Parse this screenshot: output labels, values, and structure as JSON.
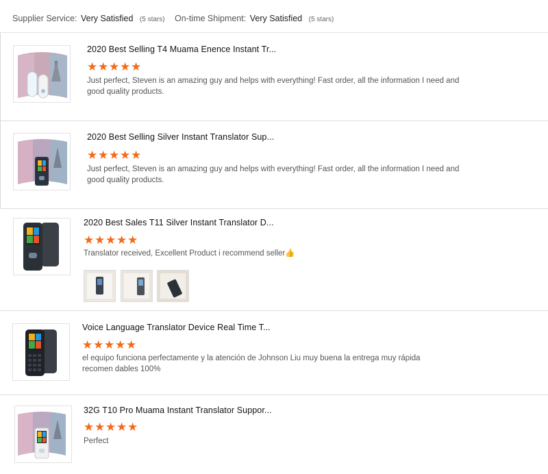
{
  "summary": {
    "supplier_label": "Supplier Service:",
    "supplier_value": "Very Satisfied",
    "supplier_stars": "(5 stars)",
    "shipment_label": "On-time Shipment:",
    "shipment_value": "Very Satisfied",
    "shipment_stars": "(5 stars)"
  },
  "colors": {
    "star": "#f26a1b",
    "divider": "#dcdcdc"
  },
  "reviews": [
    {
      "title": "2020 Best Selling T4 Muama Enence Instant Tr...",
      "stars": 5,
      "text": "Just perfect, Steven is an amazing guy and helps with everything! Fast order, all the information  I need and good quality products.",
      "thumb_icon": "product-thumbnail-t4-translator"
    },
    {
      "title": "2020 Best Selling Silver Instant Translator Sup...",
      "stars": 5,
      "text": "Just perfect, Steven is an amazing guy and helps with everything! Fast order, all the information  I need and good quality products.",
      "thumb_icon": "product-thumbnail-silver-translator"
    },
    {
      "title": "2020 Best Sales T11 Silver Instant Translator D...",
      "stars": 5,
      "text": "Translator received,  Excellent Product i recommend seller👍",
      "thumb_icon": "product-thumbnail-t11-translator",
      "photos": [
        "review-photo-1",
        "review-photo-2",
        "review-photo-3"
      ]
    },
    {
      "title": "Voice Language Translator Device Real Time T...",
      "stars": 5,
      "text": "el equipo funciona perfectamente y la atención de Johnson Liu muy buena la entrega muy rápida recomen dables 100%",
      "thumb_icon": "product-thumbnail-voice-translator"
    },
    {
      "title": "32G T10 Pro Muama Instant Translator Suppor...",
      "stars": 5,
      "text": "Perfect",
      "thumb_icon": "product-thumbnail-t10-translator"
    }
  ]
}
